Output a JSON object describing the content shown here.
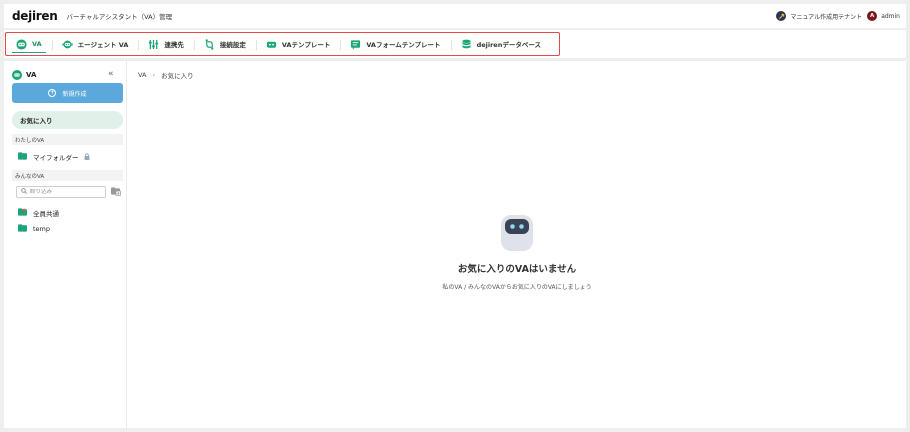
{
  "header": {
    "logo": "dejiren",
    "app_title": "バーチャルアシスタント（VA）管理",
    "tenant_name": "マニュアル作成用テナント",
    "avatar_initial": "A",
    "user_name": "admin"
  },
  "tabs": [
    {
      "label": "VA",
      "icon": "robot-icon",
      "active": true
    },
    {
      "label": "エージェント VA",
      "icon": "agent-icon",
      "active": false
    },
    {
      "label": "連携先",
      "icon": "sliders-icon",
      "active": false
    },
    {
      "label": "接続設定",
      "icon": "connection-icon",
      "active": false
    },
    {
      "label": "VAテンプレート",
      "icon": "template-icon",
      "active": false
    },
    {
      "label": "VAフォームテンプレート",
      "icon": "form-template-icon",
      "active": false
    },
    {
      "label": "dejirenデータベース",
      "icon": "database-icon",
      "active": false
    }
  ],
  "sidebar": {
    "title": "VA",
    "new_button": "新規作成",
    "favorites": "お気に入り",
    "my_va_label": "わたしのVA",
    "my_folder": "マイフォルダー",
    "everyone_va_label": "みんなのVA",
    "filter_placeholder": "絞り込み",
    "folders": [
      "全員共通",
      "temp"
    ]
  },
  "breadcrumb": {
    "root": "VA",
    "current": "お気に入り"
  },
  "empty_state": {
    "title": "お気に入りのVAはいません",
    "subtitle": "私のVA / みんなのVAからお気に入りのVAにしましょう"
  },
  "colors": {
    "accent": "#1aa57a",
    "primary_button": "#5aa8dc",
    "highlight_border": "#e64b4b",
    "folder": "#1aa57a"
  }
}
